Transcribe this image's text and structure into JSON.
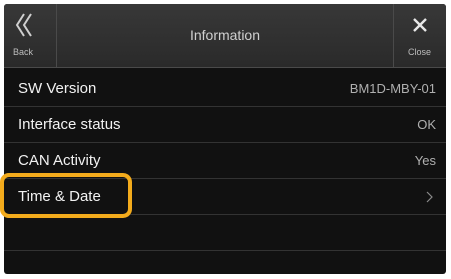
{
  "header": {
    "title": "Information",
    "back_label": "Back",
    "close_label": "Close"
  },
  "rows": [
    {
      "label": "SW Version",
      "value": "BM1D-MBY-01"
    },
    {
      "label": "Interface status",
      "value": "OK"
    },
    {
      "label": "CAN Activity",
      "value": "Yes"
    },
    {
      "label": "Time & Date",
      "value": ""
    }
  ],
  "colors": {
    "highlight": "#f3ab1c",
    "background": "#111111",
    "titlebar": "#2f2f2f"
  },
  "icons": {
    "back": "double-chevron-left-icon",
    "close": "close-icon",
    "row_arrow": "chevron-right-icon"
  }
}
